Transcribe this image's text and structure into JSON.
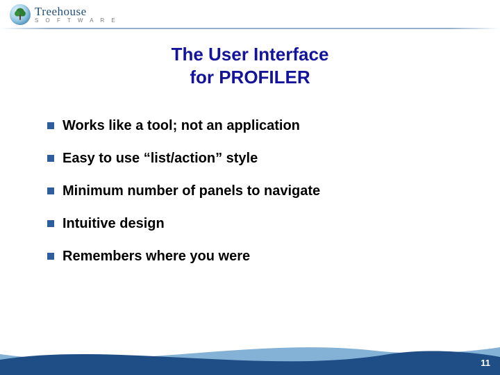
{
  "logo": {
    "name": "Treehouse",
    "tagline": "S O F T W A R E"
  },
  "title": {
    "line1": "The User Interface",
    "line2": "for PROFILER"
  },
  "bullets": [
    "Works like a tool; not an application",
    "Easy to use “list/action” style",
    "Minimum number of panels to navigate",
    "Intuitive design",
    "Remembers where you were"
  ],
  "page_number": "11",
  "colors": {
    "title": "#14149a",
    "bullet_square": "#2e5e9e",
    "wave_dark": "#1f4e87",
    "wave_light": "#6fa3cf"
  }
}
